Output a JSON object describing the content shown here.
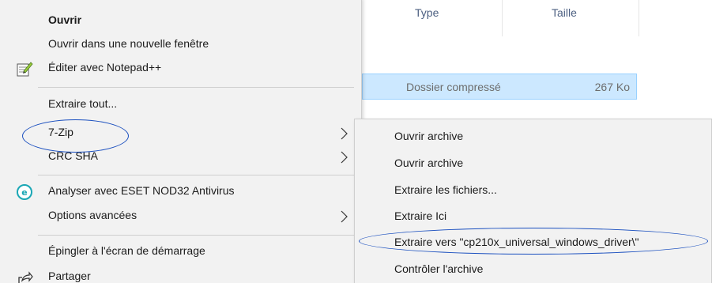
{
  "explorer": {
    "columns": {
      "type": "Type",
      "size": "Taille"
    },
    "file": {
      "type": "Dossier compressé",
      "size": "267 Ko"
    }
  },
  "context_menu": {
    "items": [
      {
        "label": "Ouvrir",
        "bold": true
      },
      {
        "label": "Ouvrir dans une nouvelle fenêtre"
      },
      {
        "label": "Éditer avec Notepad++",
        "icon": "notepad-plus-plus-icon"
      },
      {
        "label": "Extraire tout..."
      },
      {
        "label": "7-Zip",
        "submenu": true
      },
      {
        "label": "CRC SHA",
        "submenu": true
      },
      {
        "label": "Analyser avec ESET NOD32 Antivirus",
        "icon": "eset-icon"
      },
      {
        "label": "Options avancées",
        "submenu": true
      },
      {
        "label": "Épingler à l'écran de démarrage"
      },
      {
        "label": "Partager",
        "icon": "share-icon"
      }
    ]
  },
  "submenu_7zip": {
    "items": [
      {
        "label": "Ouvrir archive"
      },
      {
        "label": "Ouvrir archive"
      },
      {
        "label": "Extraire les fichiers..."
      },
      {
        "label": "Extraire Ici"
      },
      {
        "label": "Extraire vers \"cp210x_universal_windows_driver\\\""
      },
      {
        "label": "Contrôler l'archive"
      }
    ]
  },
  "colors": {
    "menu_bg": "#f2f2f2",
    "selection_bg": "#cce8ff",
    "annotation": "#1a4fbf",
    "eset_accent": "#1aa7b5"
  }
}
